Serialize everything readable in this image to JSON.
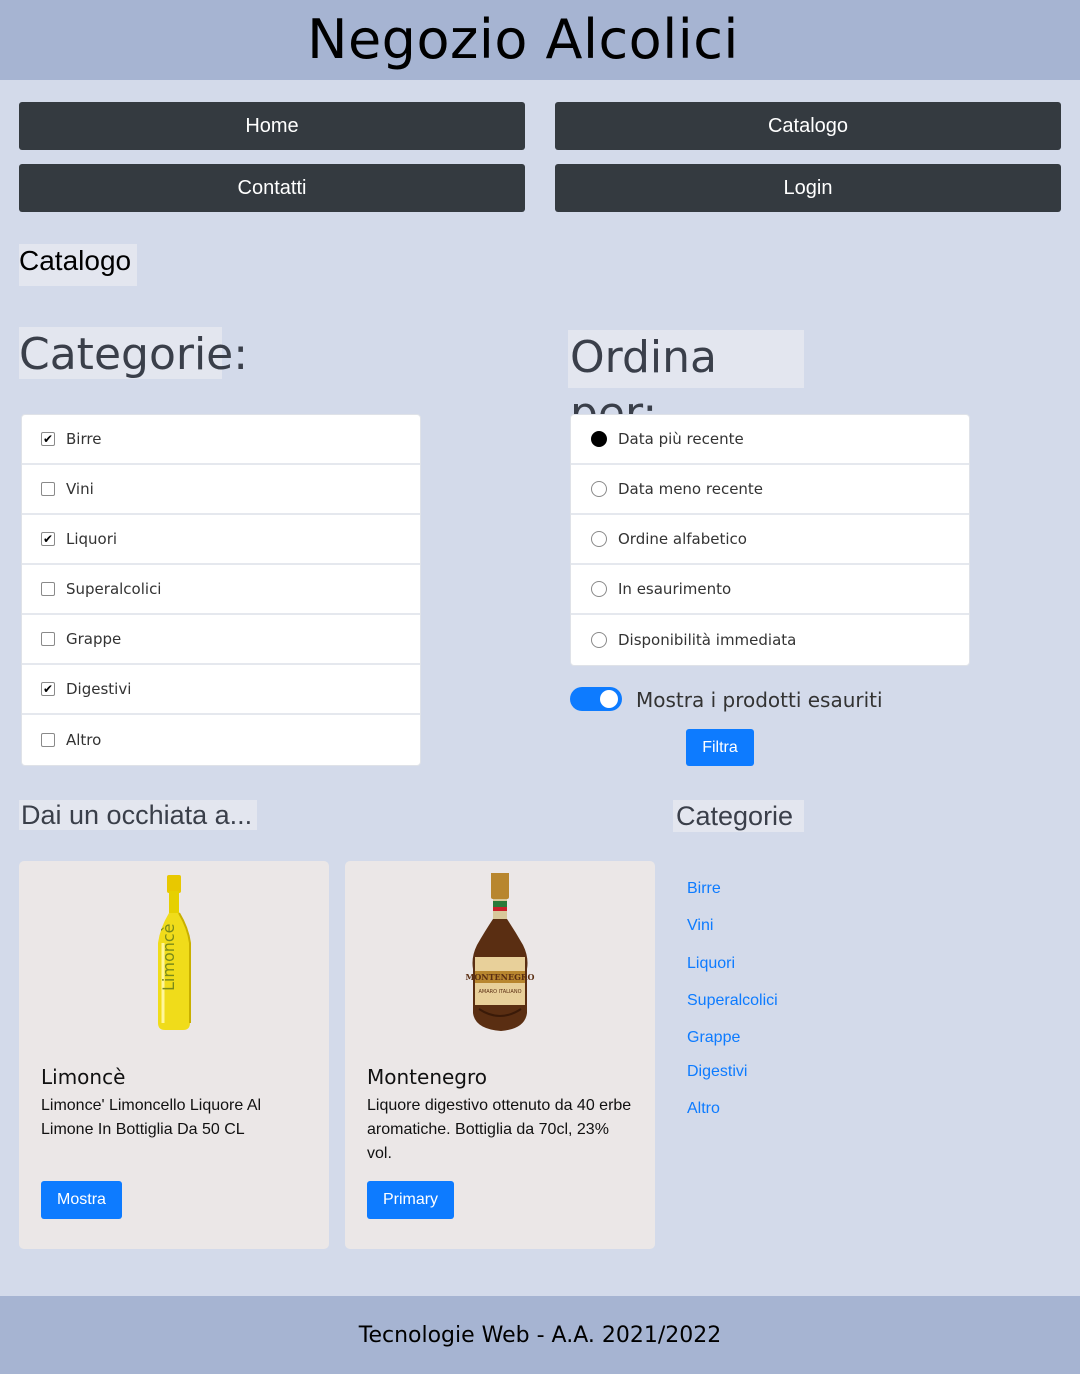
{
  "header": {
    "title": "Negozio Alcolici"
  },
  "nav": {
    "home": "Home",
    "catalogo": "Catalogo",
    "contatti": "Contatti",
    "login": "Login"
  },
  "page_heading": "Catalogo",
  "categories_filter": {
    "heading": "Categorie:",
    "items": [
      {
        "label": "Birre",
        "checked": true
      },
      {
        "label": "Vini",
        "checked": false
      },
      {
        "label": "Liquori",
        "checked": true
      },
      {
        "label": "Superalcolici",
        "checked": false
      },
      {
        "label": "Grappe",
        "checked": false
      },
      {
        "label": "Digestivi",
        "checked": true
      },
      {
        "label": "Altro",
        "checked": false
      }
    ]
  },
  "sort": {
    "heading": "Ordina per:",
    "options": [
      {
        "label": "Data più recente",
        "selected": true
      },
      {
        "label": "Data meno recente",
        "selected": false
      },
      {
        "label": "Ordine alfabetico",
        "selected": false
      },
      {
        "label": "In esaurimento",
        "selected": false
      },
      {
        "label": "Disponibilità immediata",
        "selected": false
      }
    ]
  },
  "toggle": {
    "label": "Mostra i prodotti esauriti",
    "on": true
  },
  "filter_button": "Filtra",
  "featured": {
    "heading": "Dai un occhiata a...",
    "cards": [
      {
        "title": "Limoncè",
        "text": "Limonce' Limoncello Liquore Al Limone In Bottiglia Da 50 CL",
        "button": "Mostra"
      },
      {
        "title": "Montenegro",
        "text": "Liquore digestivo ottenuto da 40 erbe aromatiche. Bottiglia da 70cl, 23% vol.",
        "button": "Primary"
      }
    ]
  },
  "sidebar": {
    "heading": "Categorie",
    "links": [
      "Birre",
      "Vini",
      "Liquori",
      "Superalcolici",
      "Grappe",
      "Digestivi",
      "Altro"
    ]
  },
  "footer": {
    "text": "Tecnologie Web - A.A. 2021/2022"
  },
  "colors": {
    "background": "#d3daea",
    "header": "#a6b4d2",
    "nav_button": "#343a40",
    "accent": "#0d7bff"
  }
}
